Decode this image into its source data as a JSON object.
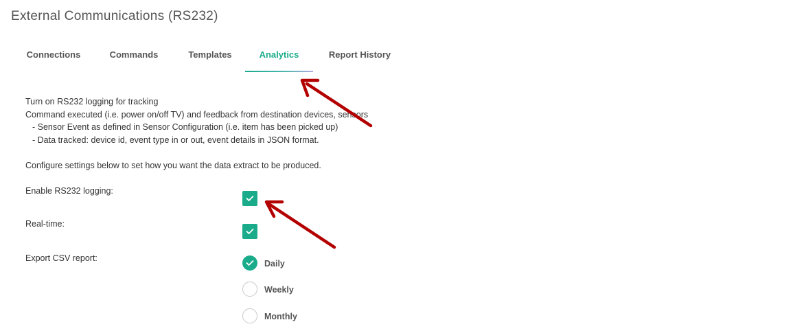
{
  "page": {
    "title": "External Communications (RS232)"
  },
  "tabs": [
    {
      "label": "Connections",
      "active": false
    },
    {
      "label": "Commands",
      "active": false
    },
    {
      "label": "Templates",
      "active": false
    },
    {
      "label": "Analytics",
      "active": true
    },
    {
      "label": "Report History",
      "active": false
    }
  ],
  "description": {
    "line1": "Turn on RS232 logging for tracking",
    "line2": "Command executed (i.e. power on/off TV) and feedback from destination devices, sensors",
    "line3": "- Sensor Event as defined in Sensor Configuration (i.e. item has been picked up)",
    "line4": "- Data tracked: device id, event type in or out, event details in JSON format.",
    "line5": "Configure settings below to set how you want the data extract to be produced."
  },
  "settings": {
    "enable_logging": {
      "label": "Enable RS232 logging:",
      "checked": true
    },
    "realtime": {
      "label": "Real-time:",
      "checked": true
    },
    "export_csv": {
      "label": "Export CSV report:",
      "options": [
        {
          "label": "Daily",
          "selected": true
        },
        {
          "label": "Weekly",
          "selected": false
        },
        {
          "label": "Monthly",
          "selected": false
        }
      ]
    }
  },
  "colors": {
    "accent": "#1aab8b",
    "annotation_arrow": "#b30000",
    "text": "#333333"
  },
  "icons": {
    "check": "checkmark-icon",
    "arrow": "annotation-arrow-icon"
  }
}
